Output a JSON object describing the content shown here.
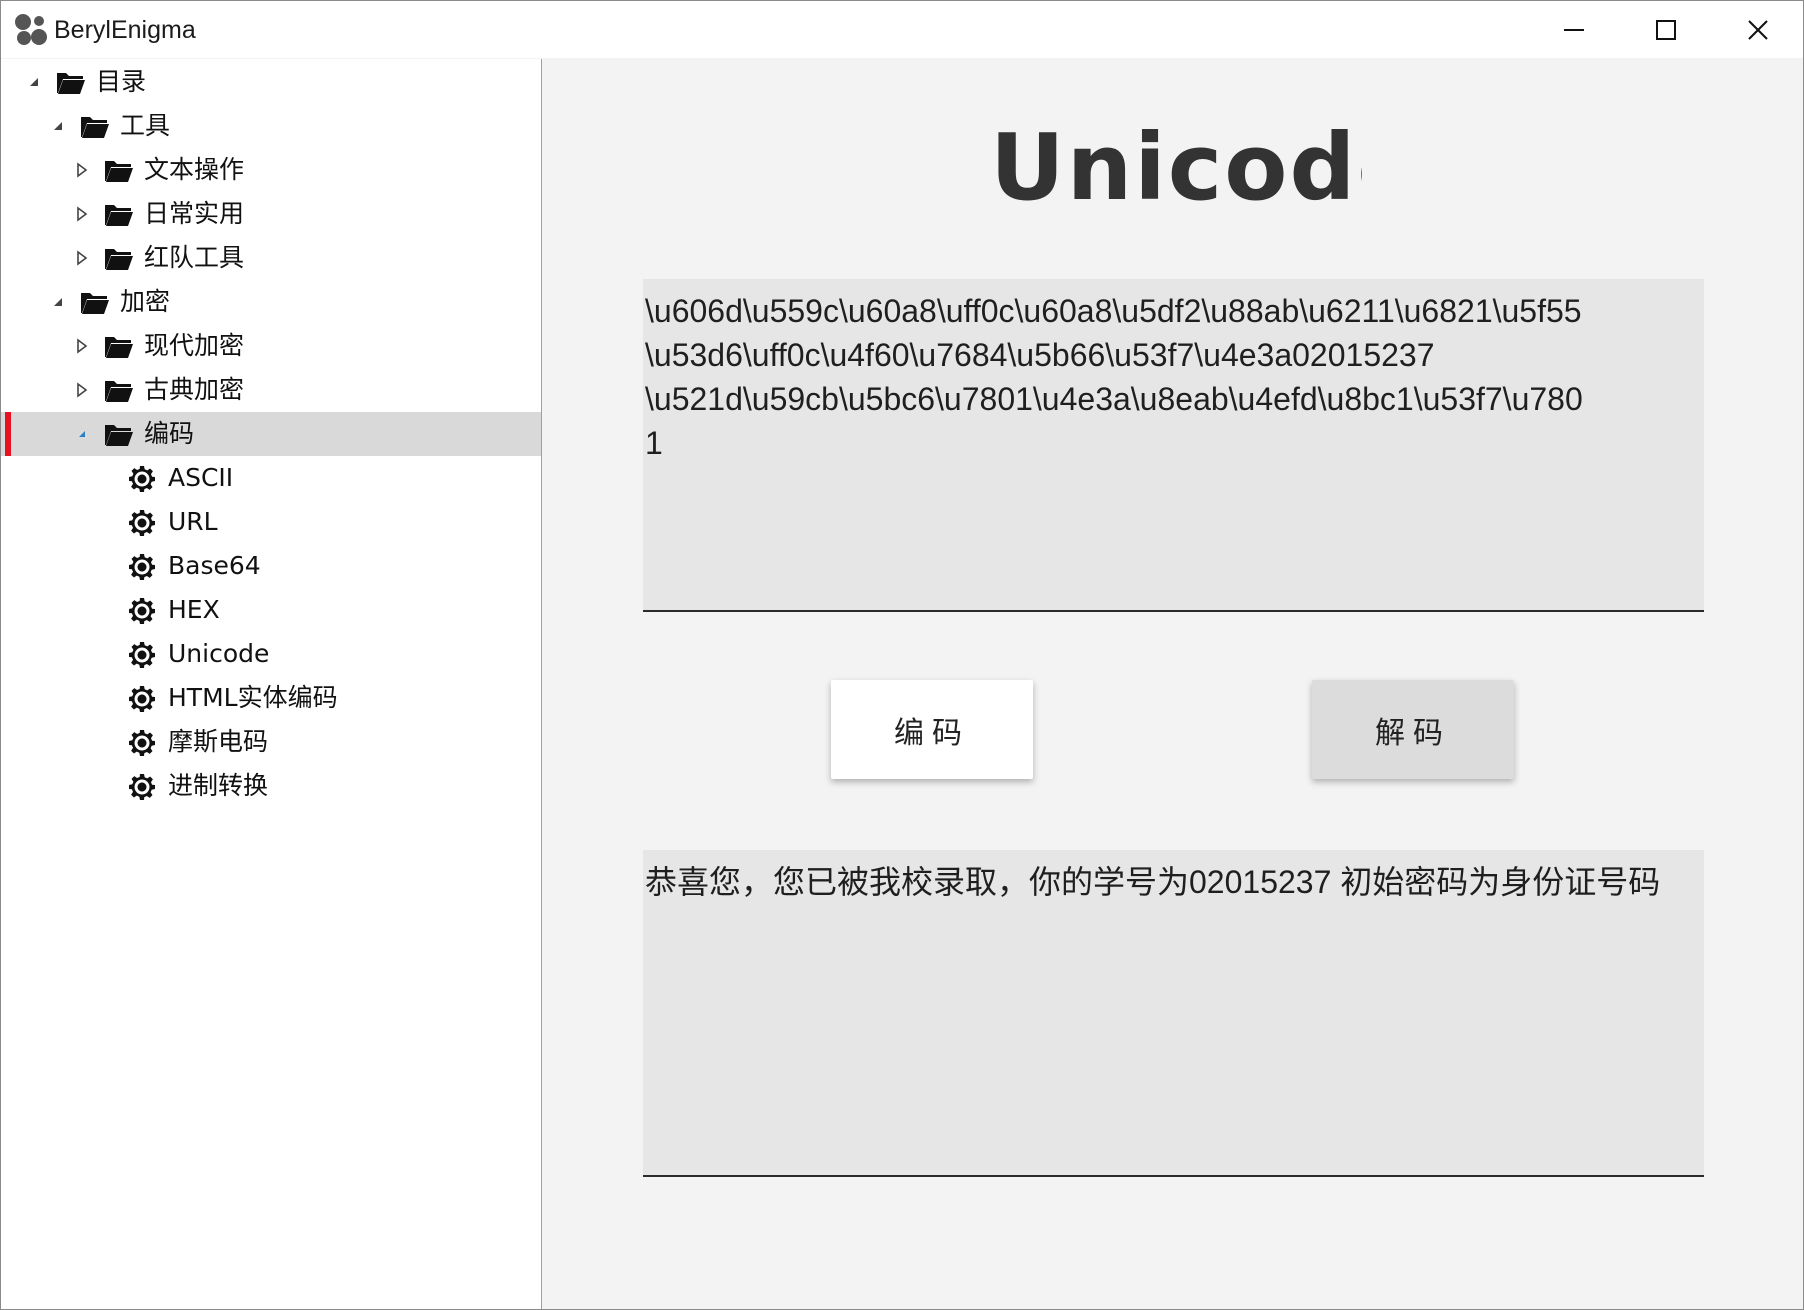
{
  "window": {
    "title": "BerylEnigma",
    "controls": [
      "minimize-icon",
      "maximize-icon",
      "close-icon"
    ]
  },
  "tree": {
    "items": [
      {
        "label": "目录",
        "icon": "folder-open-icon",
        "expander": "expanded"
      },
      {
        "label": "工具",
        "icon": "folder-open-icon",
        "expander": "expanded"
      },
      {
        "label": "文本操作",
        "icon": "folder-open-icon",
        "expander": "collapsed"
      },
      {
        "label": "日常实用",
        "icon": "folder-open-icon",
        "expander": "collapsed"
      },
      {
        "label": "红队工具",
        "icon": "folder-open-icon",
        "expander": "collapsed"
      },
      {
        "label": "加密",
        "icon": "folder-open-icon",
        "expander": "expanded"
      },
      {
        "label": "现代加密",
        "icon": "folder-open-icon",
        "expander": "collapsed"
      },
      {
        "label": "古典加密",
        "icon": "folder-open-icon",
        "expander": "collapsed"
      },
      {
        "label": "编码",
        "icon": "folder-open-icon",
        "expander": "expanded",
        "selected": true
      },
      {
        "label": "ASCII",
        "icon": "gear-icon"
      },
      {
        "label": "URL",
        "icon": "gear-icon"
      },
      {
        "label": "Base64",
        "icon": "gear-icon"
      },
      {
        "label": "HEX",
        "icon": "gear-icon"
      },
      {
        "label": "Unicode",
        "icon": "gear-icon"
      },
      {
        "label": "HTML实体编码",
        "icon": "gear-icon"
      },
      {
        "label": "摩斯电码",
        "icon": "gear-icon"
      },
      {
        "label": "进制转换",
        "icon": "gear-icon"
      }
    ]
  },
  "main": {
    "logo_text": "Unicode",
    "input_text": "\\u606d\\u559c\\u60a8\\uff0c\\u60a8\\u5df2\\u88ab\\u6211\\u6821\\u5f55\n\\u53d6\\uff0c\\u4f60\\u7684\\u5b66\\u53f7\\u4e3a02015237\n\\u521d\\u59cb\\u5bc6\\u7801\\u4e3a\\u8eab\\u4efd\\u8bc1\\u53f7\\u780\n1",
    "encode_label": "编码",
    "decode_label": "解码",
    "output_text": "恭喜您，您已被我校录取，你的学号为02015237 初始密码为身份证号码"
  },
  "colors": {
    "selection_accent": "#e81123",
    "selection_bg": "#d9d9d9",
    "textbox_bg": "#e6e6e6",
    "content_bg": "#f3f3f3"
  }
}
